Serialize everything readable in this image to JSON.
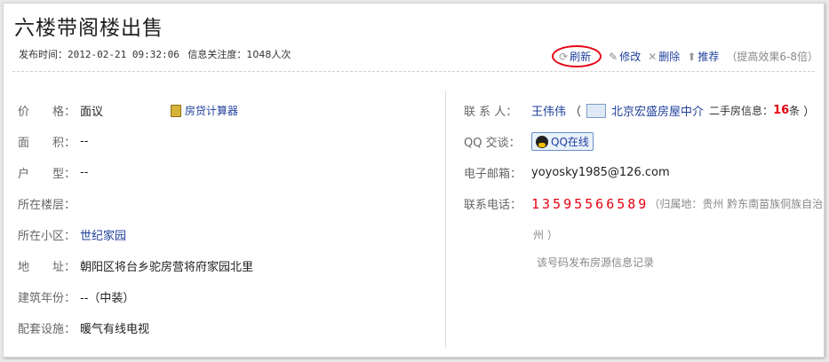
{
  "title": "六楼带阁楼出售",
  "meta": {
    "publish_label": "发布时间：",
    "publish_time": "2012-02-21 09:32:06",
    "attention_label": "信息关注度：",
    "attention_value": "1048人次"
  },
  "actions": {
    "refresh": "刷新",
    "edit": "修改",
    "delete": "删除",
    "recommend": "推荐",
    "hint": "（提高效果6-8倍）"
  },
  "left_rows": [
    {
      "label": "价　　格：",
      "value": "面议"
    },
    {
      "label": "面　　积：",
      "value": "--"
    },
    {
      "label": "户　　型：",
      "value": "--"
    },
    {
      "label": "所在楼层：",
      "value": ""
    },
    {
      "label": "所在小区：",
      "value": "世纪家园"
    },
    {
      "label": "地　　址：",
      "value": "朝阳区将台乡驼房营将府家园北里"
    },
    {
      "label": "建筑年份：",
      "value": "--（中装）"
    },
    {
      "label": "配套设施：",
      "value": "暖气有线电视"
    }
  ],
  "calculator": "房贷计算器",
  "contact": {
    "person_label": "联 系 人：",
    "person": "王伟伟",
    "agency": "北京宏盛房屋中介",
    "listings_label": "二手房信息：",
    "listings_count": "16",
    "listings_unit": "条",
    "qq_label": "QQ 交谈：",
    "qq_button": "QQ在线",
    "email_label": "电子邮箱：",
    "email": "yoyosky1985@126.com",
    "phone_label": "联系电话：",
    "phone": "13595566589",
    "location": "（归属地：贵州  黔东南苗族侗族自治",
    "location2": "州 ）",
    "record_link": "该号码发布房源信息记录"
  }
}
